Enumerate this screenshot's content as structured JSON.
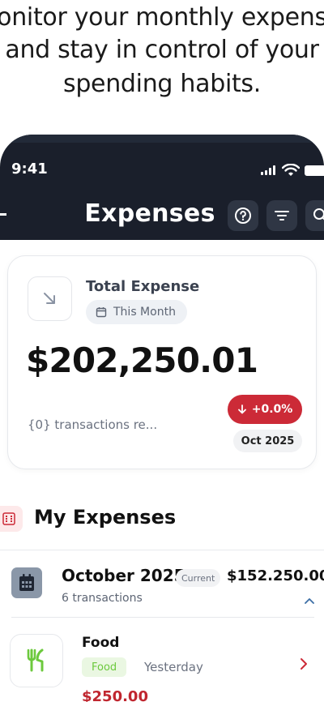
{
  "headline": {
    "line1": "onitor your monthly expens",
    "line2": "and stay in control of your",
    "line3": "spending habits."
  },
  "status_bar": {
    "time": "9:41"
  },
  "header": {
    "title": "Expenses"
  },
  "summary": {
    "title": "Total Expense",
    "period": "This Month",
    "amount": "$202,250.01",
    "transactions_text": "{0} transactions re...",
    "change": "+0.0%",
    "month": "Oct 2025"
  },
  "section": {
    "title": "My Expenses"
  },
  "month_group": {
    "name": "October 2025",
    "badge": "Current",
    "amount": "$152.250.00",
    "count": "6 transactions"
  },
  "expense": {
    "name": "Food",
    "category": "Food",
    "when": "Yesterday",
    "amount": "$250.00"
  },
  "colors": {
    "header_bg": "#1a1f2b",
    "danger": "#cc2a37",
    "food_green": "#6cc93d"
  }
}
